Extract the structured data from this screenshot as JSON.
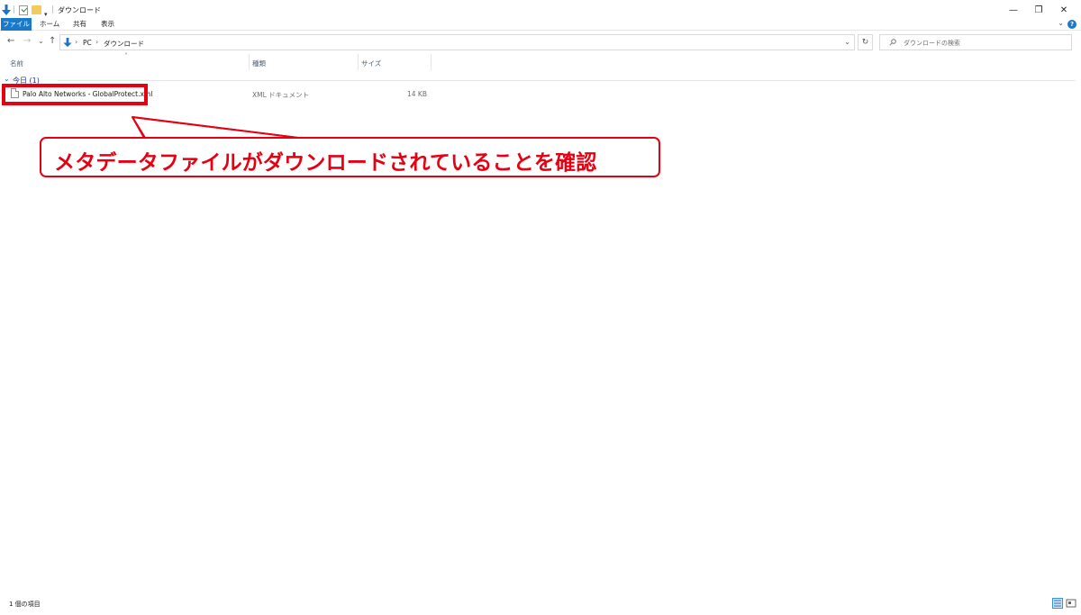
{
  "window": {
    "title": "ダウンロード",
    "minimize": "—",
    "restore": "❐",
    "close": "✕"
  },
  "ribbon": {
    "tabs": [
      "ファイル",
      "ホーム",
      "共有",
      "表示"
    ],
    "help": "?"
  },
  "nav": {
    "back": "←",
    "forward": "→",
    "recent": "⌄",
    "up": "↑",
    "breadcrumb": [
      "PC",
      "ダウンロード"
    ],
    "crumb_separator": "›",
    "refresh": "↻",
    "search_placeholder": "ダウンロードの検索"
  },
  "columns": {
    "name": "名前",
    "type": "種類",
    "size": "サイズ"
  },
  "group": {
    "label": "今日 (1)"
  },
  "files": [
    {
      "name": "Palo Alto Networks - GlobalProtect.xml",
      "type": "XML ドキュメント",
      "size": "14 KB"
    }
  ],
  "annotation": {
    "text": "メタデータファイルがダウンロードされていることを確認",
    "color": "#e60012"
  },
  "status": {
    "item_count": "1 個の項目"
  },
  "colors": {
    "accent": "#1979ca",
    "annotation_red": "#e60012"
  }
}
